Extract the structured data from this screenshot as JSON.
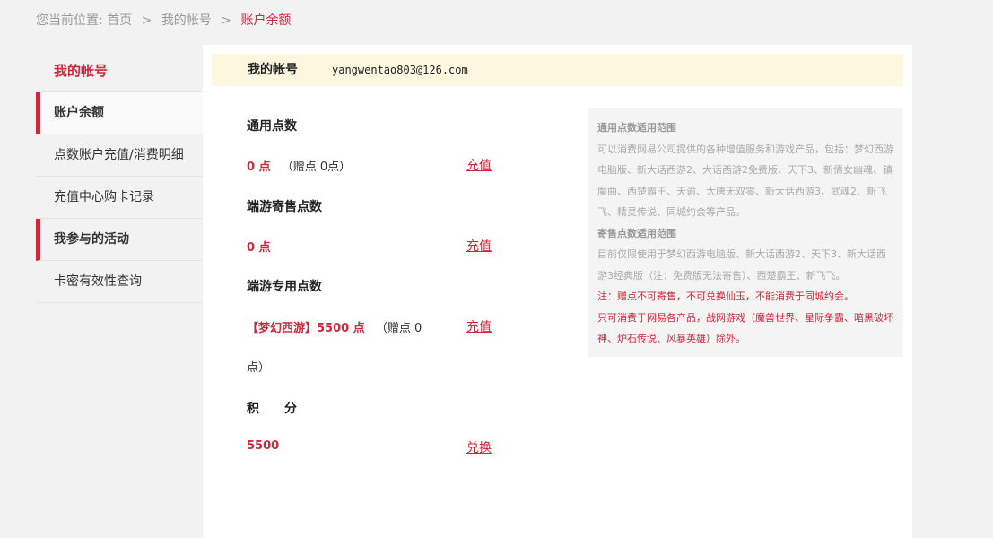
{
  "breadcrumb": {
    "prefix": "您当前位置:",
    "home": "首页",
    "account": "我的帐号",
    "current": "账户余额",
    "separator": ">"
  },
  "sidebar": {
    "title": "我的帐号",
    "items": [
      {
        "label": "账户余额",
        "active": true
      },
      {
        "label": "点数账户充值/消费明细",
        "active": false
      },
      {
        "label": "充值中心购卡记录",
        "active": false
      },
      {
        "label": "我参与的活动",
        "active": true
      },
      {
        "label": "卡密有效性查询",
        "active": false
      }
    ]
  },
  "account": {
    "label": "我的帐号",
    "email": "yangwentao803@126.com"
  },
  "points": {
    "general": {
      "title": "通用点数",
      "amount": "0 点",
      "bonus": "（赠点 0点）",
      "action": "充值"
    },
    "consign": {
      "title": "端游寄售点数",
      "amount": "0 点",
      "action": "充值"
    },
    "dedicated": {
      "title": "端游专用点数",
      "game": "【梦幻西游】5500 点",
      "bonus_line1": "（赠点 0",
      "bonus_line2": "点）",
      "action": "充值"
    },
    "score": {
      "title": "积　　分",
      "amount": "5500",
      "action": "兑换"
    }
  },
  "info": {
    "general_title": "通用点数适用范围",
    "general_body": "可以消费网易公司提供的各种增值服务和游戏产品，包括：梦幻西游电脑版、新大话西游2、大话西游2免费版、天下3、新倩女幽魂、镇魔曲、西楚霸王、天谕、大唐无双零、新大话西游3、武魂2、新飞飞、精灵传说、同城约会等产品。",
    "consign_title": "寄售点数适用范围",
    "consign_body": "目前仅限使用于梦幻西游电脑版、新大话西游2、天下3、新大话西游3经典版（注：免费版无法寄售）、西楚霸王、新飞飞。",
    "warn1": "注：赠点不可寄售，不可兑换仙玉，不能消费于同城约会。",
    "warn2": "只可消费于网易各产品，战网游戏（魔兽世界、星际争霸、暗黑破坏神、炉石传说、风暴英雄）除外。"
  },
  "colors": {
    "accent": "#d2273a",
    "account_bar": "#fdf7df",
    "page_bg": "#f2f2f2",
    "info_bg": "#f4f4f4"
  }
}
